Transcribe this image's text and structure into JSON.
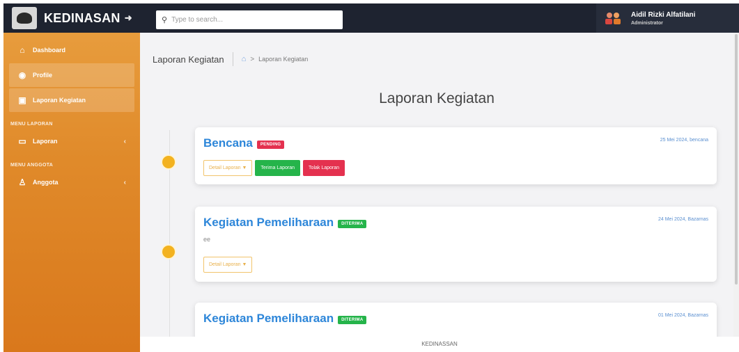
{
  "brand": {
    "name": "KEDINASAN",
    "toggle_icon": "collapse-arrow-icon"
  },
  "search": {
    "placeholder": "Type to search..."
  },
  "user": {
    "name": "Aidil Rizki Alfatilani",
    "role": "Administrator"
  },
  "sidebar": {
    "items": [
      {
        "label": "Dashboard",
        "icon": "home-icon"
      },
      {
        "label": "Profile",
        "icon": "user-circle-icon"
      },
      {
        "label": "Laporan Kegiatan",
        "icon": "document-icon"
      }
    ],
    "sections": [
      {
        "heading": "MENU LAPORAN",
        "item": {
          "label": "Laporan",
          "icon": "monitor-icon"
        }
      },
      {
        "heading": "MENU ANGGOTA",
        "item": {
          "label": "Anggota",
          "icon": "person-icon"
        }
      }
    ]
  },
  "breadcrumb": {
    "title": "Laporan Kegiatan",
    "current": "Laporan Kegiatan"
  },
  "page": {
    "title": "Laporan Kegiatan"
  },
  "reports": [
    {
      "title": "Bencana",
      "status": "PENDING",
      "date": "25 Mei 2024, bencana",
      "description": "",
      "detail_label": "Detail Laporan ▼",
      "accept_label": "Terima Laporan",
      "reject_label": "Tolak Laporan"
    },
    {
      "title": "Kegiatan Pemeliharaan",
      "status": "DITERIMA",
      "date": "24 Mei 2024, Bazarnas",
      "description": "ee",
      "detail_label": "Detail Laporan ▼"
    },
    {
      "title": "Kegiatan Pemeliharaan",
      "status": "DITERIMA",
      "date": "01 Mei 2024, Bazarnas",
      "description": ""
    }
  ],
  "footer": {
    "text": "KEDINASSAN"
  },
  "colors": {
    "sidebar": "#e08a2a",
    "topbar": "#1e2330",
    "accent": "#2d86d9",
    "pending": "#e4314f",
    "accepted": "#25b44a",
    "dot": "#f3b21f"
  }
}
